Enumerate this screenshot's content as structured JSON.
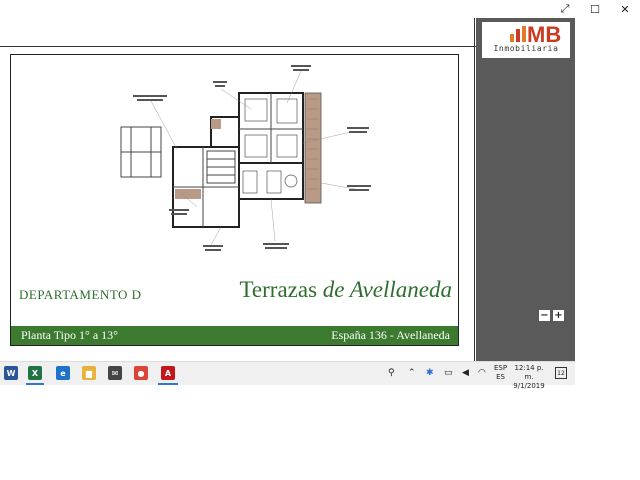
{
  "window": {
    "restore_glyph": "⤢",
    "maximize_glyph": "☐",
    "close_glyph": "✕"
  },
  "document": {
    "department_label": "DEPARTAMENTO  D",
    "brand_main": "Terrazas ",
    "brand_italic": "de Avellaneda",
    "floor_label": "Planta Tipo 1° a 13°",
    "address": "España 136 - Avellaneda"
  },
  "logo": {
    "initials": "MB",
    "subtitle": "Inmobiliaria"
  },
  "zoom": {
    "minus": "−",
    "plus": "+"
  },
  "taskbar": {
    "apps": [
      {
        "name": "word",
        "glyph": "W",
        "color": "#2b579a"
      },
      {
        "name": "excel",
        "glyph": "X",
        "color": "#217346"
      },
      {
        "name": "edge",
        "glyph": "e",
        "color": "#1e73c8"
      },
      {
        "name": "file-explorer",
        "glyph": "▆",
        "color": "#e8b13a"
      },
      {
        "name": "mail",
        "glyph": "✉",
        "color": "#444444"
      },
      {
        "name": "chrome",
        "glyph": "●",
        "color": "#db4437"
      },
      {
        "name": "acrobat",
        "glyph": "A",
        "color": "#c4161c"
      }
    ],
    "language": "ESP",
    "region": "ES",
    "time": "12:14 p. m.",
    "date": "9/1/2019",
    "notifications": "12"
  }
}
